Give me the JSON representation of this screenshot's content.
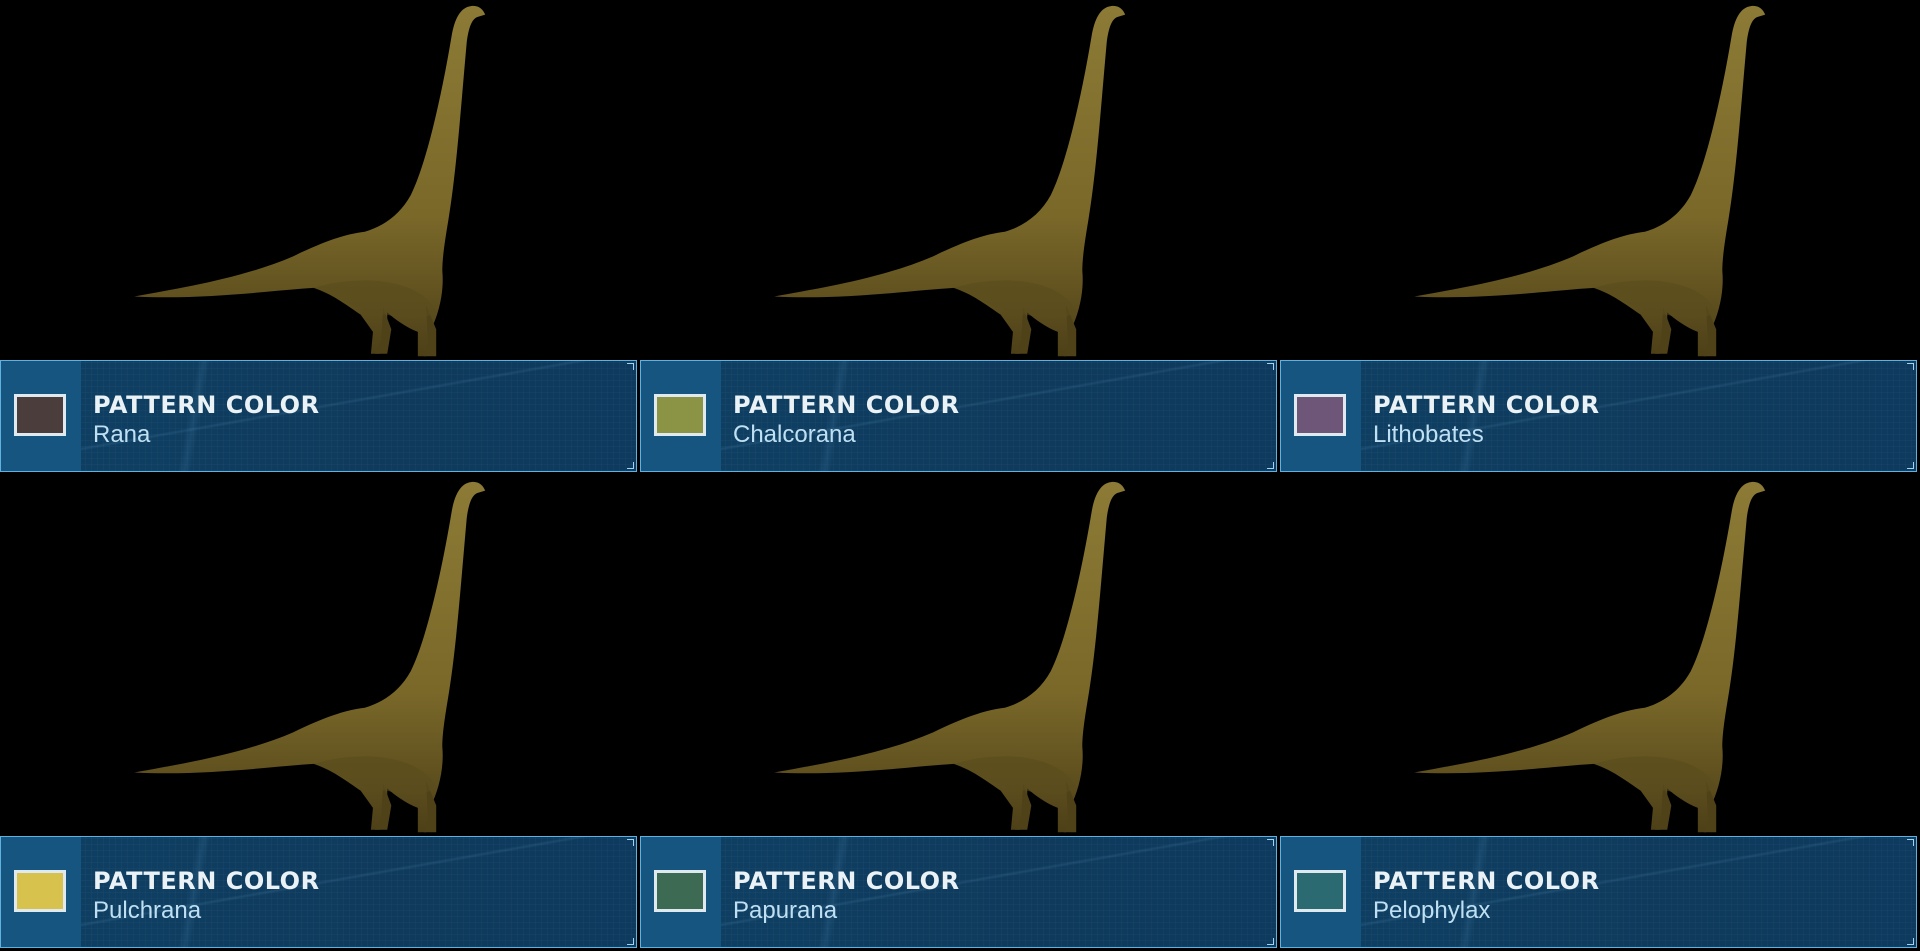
{
  "cells": [
    {
      "title": "PATTERN COLOR",
      "name": "Rana",
      "swatch": "#4a3d3c"
    },
    {
      "title": "PATTERN COLOR",
      "name": "Chalcorana",
      "swatch": "#8a9444"
    },
    {
      "title": "PATTERN COLOR",
      "name": "Lithobates",
      "swatch": "#6e5678"
    },
    {
      "title": "PATTERN COLOR",
      "name": "Pulchrana",
      "swatch": "#d8c24e"
    },
    {
      "title": "PATTERN COLOR",
      "name": "Papurana",
      "swatch": "#3c6a52"
    },
    {
      "title": "PATTERN COLOR",
      "name": "Pelophylax",
      "swatch": "#2a6a70"
    }
  ],
  "colors": {
    "dino_body": "#7d6a2c",
    "dino_shade": "#4f4219",
    "dino_light": "#a08a3c",
    "panel_border": "#5fb2e0"
  }
}
